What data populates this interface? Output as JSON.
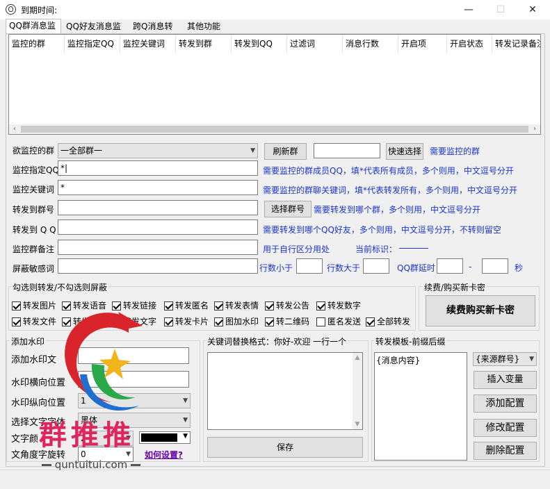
{
  "window": {
    "title": "到期时间:",
    "minimize": "—",
    "maximize": "☐",
    "close": "✕"
  },
  "tabs": [
    "QQ群消息监控",
    "QQ好友消息监控",
    "跨Q消息转发",
    "其他功能"
  ],
  "listview": {
    "columns": [
      "监控的群",
      "监控指定QQ",
      "监控关键词",
      "转发到群",
      "转发到QQ",
      "过滤词",
      "消息行数",
      "开启项",
      "开启状态",
      "转发记录备注"
    ],
    "left_arrow": "‹",
    "right_arrow": "›"
  },
  "form": {
    "monitor_group_label": "欲监控的群",
    "monitor_group_value": "一全部群一",
    "refresh_group_button": "刷新群",
    "quick_select_input": "",
    "quick_select_button": "快速选择",
    "monitor_group_hint": "需要监控的群",
    "specified_qq_label": "监控指定QQ",
    "specified_qq_value": "*|",
    "specified_qq_hint": "需要监控的群成员QQ，填*代表所有成员，多个则用，中文逗号分开",
    "keyword_label": "监控关键词",
    "keyword_value": "*",
    "keyword_hint": "需要监控的群聊关键词，填*代表转发所有，多个则用，中文逗号分开",
    "forward_group_label": "转发到群号",
    "forward_group_value": "",
    "select_group_button": "选择群号",
    "forward_group_hint": "需要转发到哪个群，多个则用，中文逗号分开",
    "forward_qq_label": "转发到 Q Q",
    "forward_qq_value": "",
    "forward_qq_hint": "需要转发到哪个QQ好友，多个则用，中文逗号分开，不转则留空",
    "remark_label": "监控群备注",
    "remark_value": "",
    "remark_hint": "用于自行区分用处",
    "current_mark_label": "当前标识：",
    "filter_label": "屏蔽敏感词",
    "filter_value": "",
    "lines_less_label": "行数小于",
    "lines_less_value": "",
    "lines_more_label": "行数大于",
    "lines_more_value": "",
    "delay_label": "QQ群延时",
    "delay_from": "",
    "delay_sep": "-",
    "delay_to": "",
    "delay_unit": "秒"
  },
  "options_group": {
    "title": "勾选则转发/不勾选则屏蔽",
    "row1": [
      {
        "label": "转发图片",
        "checked": true
      },
      {
        "label": "转发语音",
        "checked": true
      },
      {
        "label": "转发链接",
        "checked": true
      },
      {
        "label": "转发匿名",
        "checked": true
      },
      {
        "label": "转发表情",
        "checked": true
      },
      {
        "label": "转发公告",
        "checked": true
      },
      {
        "label": "转发数字",
        "checked": true
      }
    ],
    "row2": [
      {
        "label": "转发文件",
        "checked": true
      },
      {
        "label": "转发",
        "checked": true
      },
      {
        "label": "转发文字",
        "checked": true
      },
      {
        "label": "转发卡片",
        "checked": true
      },
      {
        "label": "图加水印",
        "checked": true
      },
      {
        "label": "转二维码",
        "checked": true
      },
      {
        "label": "匿名发送",
        "checked": false
      },
      {
        "label": "全部转发",
        "checked": true
      }
    ]
  },
  "renew_group": {
    "title": "续费/购买新卡密",
    "button": "续费购买新卡密"
  },
  "watermark_group": {
    "title": "添加水印",
    "text_label": "添加水印文",
    "text_value": "",
    "hpos_label": "水印横向位置",
    "hpos_value": "0",
    "vpos_label": "水印纵向位置",
    "vpos_value": "1",
    "font_label": "选择文字字体",
    "font_value": "黑体",
    "color_label": "文字颜",
    "color_value": "2",
    "rotate_label": "文角度字旋转",
    "rotate_value": "0",
    "how_link": "如何设置?",
    "color_swatch": "#000000"
  },
  "keyword_replace": {
    "title": "关键词替换格式：你好-欢迎 一行一个",
    "content": "",
    "save_button": "保存"
  },
  "template_group": {
    "title": "转发模板-前缀后缀",
    "content": "{消息内容}",
    "var_select": "{来源群号}",
    "insert_var_button": "插入变量",
    "add_config_button": "添加配置",
    "modify_config_button": "修改配置",
    "delete_config_button": "删除配置"
  },
  "watermark_overlay": {
    "brand_text": "群推推",
    "url_text": "quntuitui.com"
  },
  "colors": {
    "hint_blue": "#1a33cc",
    "brand_red": "#e0245e",
    "link_purple": "#6600aa"
  }
}
